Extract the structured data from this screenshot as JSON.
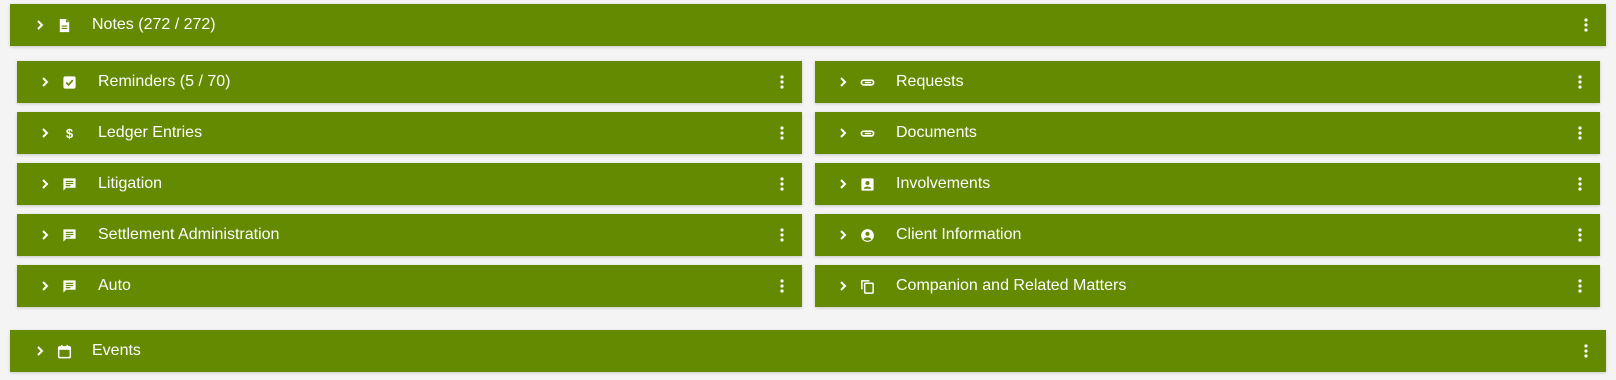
{
  "colors": {
    "panel_bg": "#638a00",
    "panel_text": "#ffffff",
    "page_bg": "#f4f4f4"
  },
  "panels": {
    "notes": {
      "label": "Notes (272 / 272)",
      "icon": "document-icon"
    },
    "reminders": {
      "label": "Reminders (5 / 70)",
      "icon": "checkbox-icon"
    },
    "requests": {
      "label": "Requests",
      "icon": "attachment-icon"
    },
    "ledger": {
      "label": "Ledger Entries",
      "icon": "dollar-icon"
    },
    "documents": {
      "label": "Documents",
      "icon": "attachment-icon"
    },
    "litigation": {
      "label": "Litigation",
      "icon": "comment-icon"
    },
    "involvements": {
      "label": "Involvements",
      "icon": "contact-card-icon"
    },
    "settlement": {
      "label": "Settlement Administration",
      "icon": "comment-icon"
    },
    "client": {
      "label": "Client Information",
      "icon": "account-circle-icon"
    },
    "auto": {
      "label": "Auto",
      "icon": "comment-icon"
    },
    "companion": {
      "label": "Companion and Related Matters",
      "icon": "copy-icon"
    },
    "events": {
      "label": "Events",
      "icon": "calendar-icon"
    }
  }
}
